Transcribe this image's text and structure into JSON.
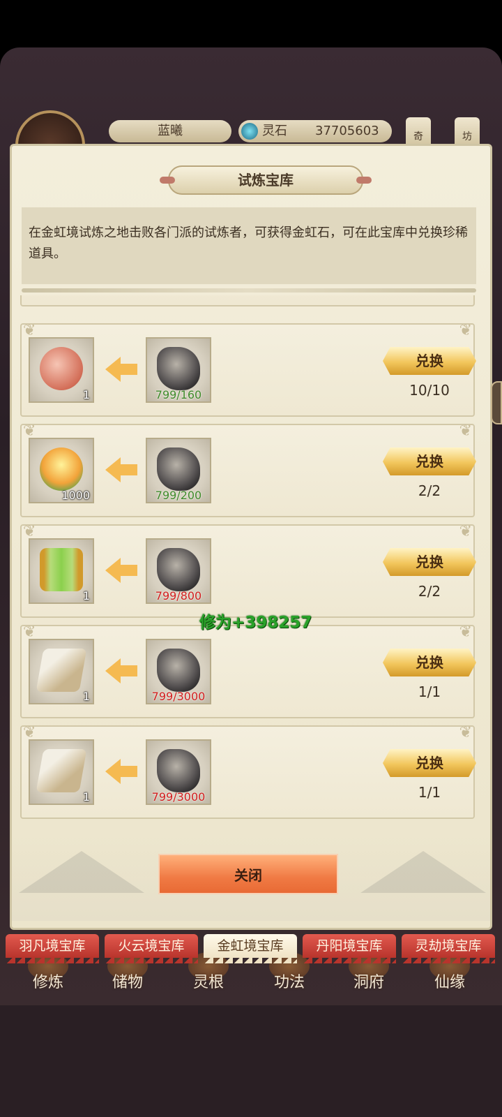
{
  "hud": {
    "player_name": "蓝曦",
    "currency_label": "灵石",
    "currency_value": "37705603",
    "side_btn_1": "奇",
    "side_btn_2": "坊"
  },
  "dialog": {
    "title": "试炼宝库",
    "description": "在金虹境试炼之地击败各门派的试炼者，可获得金虹石，可在此宝库中兑换珍稀道具。",
    "items": [
      {
        "reward_icon": "scroll-icon",
        "reward_qty": "1",
        "cost_icon": "rainbow-stone-icon",
        "cost": "799/160",
        "cost_status": "enough",
        "button": "兑换",
        "limit": "10/10"
      },
      {
        "reward_icon": "spirit-fire-icon",
        "reward_qty": "1000",
        "cost_icon": "rainbow-stone-icon",
        "cost": "799/200",
        "cost_status": "enough",
        "button": "兑换",
        "limit": "2/2"
      },
      {
        "reward_icon": "jade-banner-icon",
        "reward_qty": "1",
        "cost_icon": "rainbow-stone-icon",
        "cost": "799/800",
        "cost_status": "insufficient",
        "button": "兑换",
        "limit": "2/2"
      },
      {
        "reward_icon": "manual-book-icon",
        "reward_qty": "1",
        "cost_icon": "rainbow-stone-icon",
        "cost": "799/3000",
        "cost_status": "insufficient",
        "button": "兑换",
        "limit": "1/1"
      },
      {
        "reward_icon": "manual-book-icon",
        "reward_qty": "1",
        "cost_icon": "rainbow-stone-icon",
        "cost": "799/3000",
        "cost_status": "insufficient",
        "button": "兑换",
        "limit": "1/1"
      }
    ],
    "floating_text": "修为+398257",
    "close_label": "关闭"
  },
  "tabs": [
    {
      "label": "羽凡境宝库",
      "active": false
    },
    {
      "label": "火云境宝库",
      "active": false
    },
    {
      "label": "金虹境宝库",
      "active": true
    },
    {
      "label": "丹阳境宝库",
      "active": false
    },
    {
      "label": "灵劫境宝库",
      "active": false
    }
  ],
  "nav": [
    "修炼",
    "储物",
    "灵根",
    "功法",
    "洞府",
    "仙缘"
  ],
  "colors": {
    "cost_ok": "#3f8a2a",
    "cost_bad": "#d21e1e",
    "tab_red": "#b8342c",
    "button_gold": "#f2c65c",
    "close_orange": "#f07a44"
  }
}
